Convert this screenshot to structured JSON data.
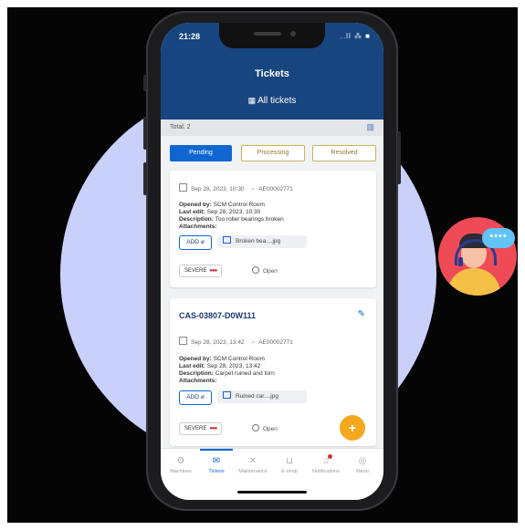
{
  "status_bar": {
    "time": "21:28",
    "icons": "..ll ⁂ ■"
  },
  "header": {
    "title": "Tickets",
    "subtitle": "All tickets"
  },
  "summary": {
    "total": "Total: 2"
  },
  "tabs": [
    {
      "label": "Pending",
      "active": true
    },
    {
      "label": "Processing",
      "active": false
    },
    {
      "label": "Resolved",
      "active": false
    }
  ],
  "tickets": [
    {
      "date": "Sep 28, 2023, 10:30",
      "ref": "AE00002771",
      "opened_by_label": "Opened by:",
      "opened_by": "SCM Control Room",
      "last_edit_label": "Last edit:",
      "last_edit": "Sep 28, 2023, 10:30",
      "description_label": "Description:",
      "description": "Too roller bearings broken",
      "attachments_label": "Attachments:",
      "attachment_chip": "ADD",
      "attachment_file": "Broken bea....jpg",
      "severity": "SEVERE",
      "severity_dots": "●●●",
      "status": "Open"
    },
    {
      "case_id": "CAS-03807-D0W111",
      "date": "Sep 28, 2023, 13:42",
      "ref": "AE00002771",
      "opened_by_label": "Opened by:",
      "opened_by": "SCM Control Room",
      "last_edit_label": "Last edit:",
      "last_edit": "Sep 28, 2023, 13:42",
      "description_label": "Description:",
      "description": "Carpet ruined and torn",
      "attachments_label": "Attachments:",
      "attachment_chip": "ADD",
      "attachment_file": "Ruined car....jpg",
      "severity": "SEVERE",
      "severity_dots": "●●●",
      "status": "Open"
    }
  ],
  "fab": {
    "label": "+"
  },
  "bottom_nav": [
    {
      "label": "Machines",
      "icon": "gears-icon"
    },
    {
      "label": "Tickets",
      "icon": "envelope-icon",
      "active": true
    },
    {
      "label": "Maintenance",
      "icon": "tools-icon"
    },
    {
      "label": "E-shop",
      "icon": "cart-icon"
    },
    {
      "label": "Notifications",
      "icon": "bell-icon"
    },
    {
      "label": "Menu",
      "icon": "menu-icon"
    }
  ],
  "chat_bubble": "••••",
  "colors": {
    "header": "#17457f",
    "accent": "#1167d1",
    "fab": "#f4a81d",
    "severity": "#c8232c",
    "backdrop_circle": "#c9d1fb"
  }
}
